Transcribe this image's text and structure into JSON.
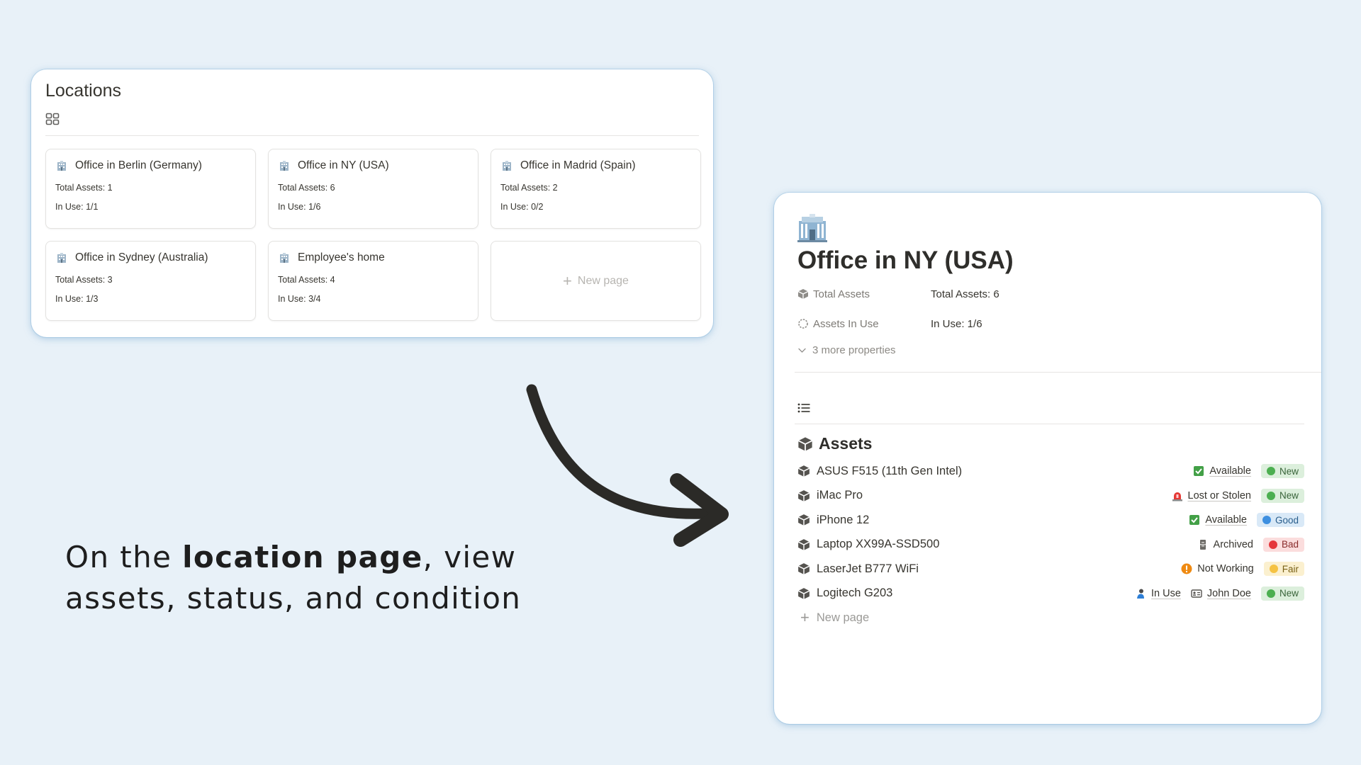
{
  "locations": {
    "title": "Locations",
    "cards": [
      {
        "name": "Office in Berlin (Germany)",
        "total": "Total Assets: 1",
        "in_use": "In Use: 1/1"
      },
      {
        "name": "Office in NY (USA)",
        "total": "Total Assets: 6",
        "in_use": "In Use: 1/6"
      },
      {
        "name": "Office in Madrid (Spain)",
        "total": "Total Assets: 2",
        "in_use": "In Use: 0/2"
      },
      {
        "name": "Office in Sydney (Australia)",
        "total": "Total Assets: 3",
        "in_use": "In Use: 1/3"
      },
      {
        "name": "Employee's home",
        "total": "Total Assets: 4",
        "in_use": "In Use: 3/4"
      }
    ],
    "new_page_label": "New page"
  },
  "caption": {
    "part1": "On the ",
    "bold": "location page",
    "part2": ", view assets, status, and condition"
  },
  "page": {
    "title": "Office in NY (USA)",
    "properties": [
      {
        "key": "Total Assets",
        "value": "Total Assets: 6",
        "icon": "box-icon"
      },
      {
        "key": "Assets In Use",
        "value": "In Use: 1/6",
        "icon": "loading-circle-icon"
      }
    ],
    "more_properties": "3 more properties",
    "assets_heading": "Assets",
    "assets": [
      {
        "name": "ASUS F515 (11th Gen Intel)",
        "status": "Available",
        "status_icon": "checkbox-icon",
        "condition": "New",
        "condition_color": "#4caf50"
      },
      {
        "name": "iMac Pro",
        "status": "Lost or Stolen",
        "status_icon": "siren-icon",
        "condition": "New",
        "condition_color": "#4caf50"
      },
      {
        "name": "iPhone 12",
        "status": "Available",
        "status_icon": "checkbox-icon",
        "condition": "Good",
        "condition_color": "#3d8fe0"
      },
      {
        "name": "Laptop XX99A-SSD500",
        "status": "Archived",
        "status_icon": "file-cabinet-icon",
        "condition": "Bad",
        "condition_color": "#e5373c"
      },
      {
        "name": "LaserJet B777 WiFi",
        "status": "Not Working",
        "status_icon": "exclamation-icon",
        "condition": "Fair",
        "condition_color": "#f5c242"
      },
      {
        "name": "Logitech G203",
        "status": "In Use",
        "status_icon": "person-icon",
        "assignee": "John Doe",
        "condition": "New",
        "condition_color": "#4caf50"
      }
    ],
    "new_page_label": "New page"
  }
}
